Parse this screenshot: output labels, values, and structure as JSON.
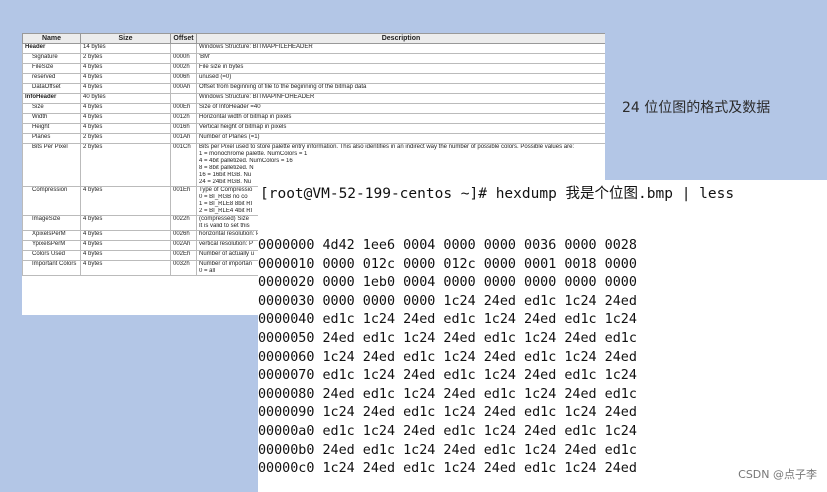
{
  "table": {
    "headers": {
      "name": "Name",
      "size": "Size",
      "offset": "Offset",
      "description": "Description"
    },
    "rows": [
      {
        "section": true,
        "name": "Header",
        "size": "14 bytes",
        "offset": "",
        "description": [
          "Windows Structure: BITMAPFILEHEADER"
        ]
      },
      {
        "name": "Signature",
        "size": "2 bytes",
        "offset": "0000h",
        "description": [
          "'BM'"
        ]
      },
      {
        "name": "FileSize",
        "size": "4 bytes",
        "offset": "0002h",
        "description": [
          "File size in bytes"
        ]
      },
      {
        "name": "reserved",
        "size": "4 bytes",
        "offset": "0006h",
        "description": [
          "unused (=0)"
        ]
      },
      {
        "name": "DataOffset",
        "size": "4 bytes",
        "offset": "000Ah",
        "description": [
          "Offset from beginning of file to the beginning of the bitmap data"
        ]
      },
      {
        "section": true,
        "name": "InfoHeader",
        "size": "40 bytes",
        "offset": "",
        "description": [
          "Windows Structure: BITMAPINFOHEADER"
        ]
      },
      {
        "name": "Size",
        "size": "4 bytes",
        "offset": "000Eh",
        "description": [
          "Size of InfoHeader =40"
        ]
      },
      {
        "name": "Width",
        "size": "4 bytes",
        "offset": "0012h",
        "description": [
          "Horizontal width of bitmap in pixels"
        ]
      },
      {
        "name": "Height",
        "size": "4 bytes",
        "offset": "0016h",
        "description": [
          "Vertical height of bitmap in pixels"
        ]
      },
      {
        "name": "Planes",
        "size": "2 bytes",
        "offset": "001Ah",
        "description": [
          "Number of Planes (=1)"
        ]
      },
      {
        "name": "Bits Per Pixel",
        "size": "2 bytes",
        "offset": "001Ch",
        "description": [
          "Bits per Pixel used to store palette entry information. This also identifies in an indirect way the number of possible colors. Possible values are:",
          "1 = monochrome palette. NumColors = 1",
          "4 = 4bit palletized. NumColors = 16",
          "8 = 8bit palletized. N",
          "16 = 16bit RGB. Nu",
          "24 = 24bit RGB. Nu"
        ]
      },
      {
        "name": "Compression",
        "size": "4 bytes",
        "offset": "001Eh",
        "description": [
          "Type of Compressio",
          "0 = BI_RGB   no co",
          "1 = BI_RLE8 8bit RI",
          "2 = BI_RLE4 4bit RI"
        ]
      },
      {
        "name": "ImageSize",
        "size": "4 bytes",
        "offset": "0022h",
        "description": [
          "(compressed) Size",
          "It is valid to set this"
        ]
      },
      {
        "name": "XpixelsPerM",
        "size": "4 bytes",
        "offset": "0026h",
        "description": [
          "horizontal resolution: P"
        ]
      },
      {
        "name": "YpixelsPerM",
        "size": "4 bytes",
        "offset": "002Ah",
        "description": [
          "vertical resolution: P"
        ]
      },
      {
        "name": "Colors Used",
        "size": "4 bytes",
        "offset": "002Eh",
        "description": [
          "Number of actually u"
        ]
      },
      {
        "name": "Important Colors",
        "size": "4 bytes",
        "offset": "0032h",
        "description": [
          "Number of importan",
          "0 = all"
        ]
      }
    ]
  },
  "caption": "24 位位图的格式及数据",
  "terminal": {
    "command": "[root@VM-52-199-centos ~]# hexdump 我是个位图.bmp | less",
    "rows": [
      "0000000 4d42 1ee6 0004 0000 0000 0036 0000 0028",
      "0000010 0000 012c 0000 012c 0000 0001 0018 0000",
      "0000020 0000 1eb0 0004 0000 0000 0000 0000 0000",
      "0000030 0000 0000 0000 1c24 24ed ed1c 1c24 24ed",
      "0000040 ed1c 1c24 24ed ed1c 1c24 24ed ed1c 1c24",
      "0000050 24ed ed1c 1c24 24ed ed1c 1c24 24ed ed1c",
      "0000060 1c24 24ed ed1c 1c24 24ed ed1c 1c24 24ed",
      "0000070 ed1c 1c24 24ed ed1c 1c24 24ed ed1c 1c24",
      "0000080 24ed ed1c 1c24 24ed ed1c 1c24 24ed ed1c",
      "0000090 1c24 24ed ed1c 1c24 24ed ed1c 1c24 24ed",
      "00000a0 ed1c 1c24 24ed ed1c 1c24 24ed ed1c 1c24",
      "00000b0 24ed ed1c 1c24 24ed ed1c 1c24 24ed ed1c",
      "00000c0 1c24 24ed ed1c 1c24 24ed ed1c 1c24 24ed"
    ]
  },
  "watermark": "CSDN @点子李"
}
